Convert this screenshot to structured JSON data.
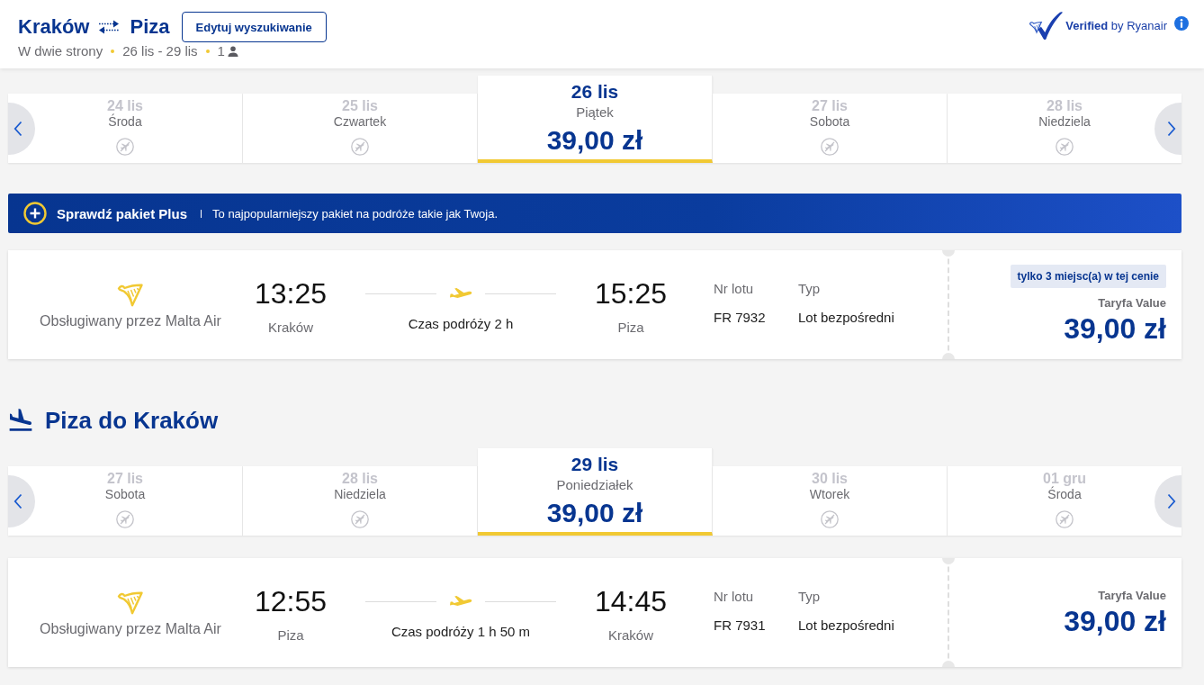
{
  "header": {
    "origin": "Kraków",
    "destination": "Piza",
    "edit_button": "Edytuj wyszukiwanie",
    "trip_type": "W dwie strony",
    "dates": "26 lis - 29 lis",
    "passengers": "1",
    "verified": "**Verified** by Ryanair"
  },
  "journeys": [
    {
      "date_tabs": [
        {
          "date": "24 lis",
          "day": "Środa",
          "selected": false
        },
        {
          "date": "25 lis",
          "day": "Czwartek",
          "selected": false
        },
        {
          "date": "26 lis",
          "day": "Piątek",
          "price": "39,00 zł",
          "selected": true
        },
        {
          "date": "27 lis",
          "day": "Sobota",
          "selected": false
        },
        {
          "date": "28 lis",
          "day": "Niedziela",
          "selected": false
        }
      ],
      "banner": {
        "title": "Sprawdź pakiet Plus",
        "text": "To najpopularniejszy pakiet na podróże takie jak Twoja."
      },
      "flight": {
        "operator": "Obsługiwany przez Malta Air",
        "departure_time": "13:25",
        "departure_city": "Kraków",
        "duration": "Czas podróży 2 h",
        "arrival_time": "15:25",
        "arrival_city": "Piza",
        "flight_number_label": "Nr lotu",
        "flight_number": "FR 7932",
        "type_label": "Typ",
        "type": "Lot bezpośredni",
        "seats_badge": "tylko 3 miejsc(a) w tej cenie",
        "fare": "Taryfa Value",
        "price": "39,00 zł"
      }
    },
    {
      "heading": "Piza do Kraków",
      "date_tabs": [
        {
          "date": "27 lis",
          "day": "Sobota",
          "selected": false
        },
        {
          "date": "28 lis",
          "day": "Niedziela",
          "selected": false
        },
        {
          "date": "29 lis",
          "day": "Poniedziałek",
          "price": "39,00 zł",
          "selected": true
        },
        {
          "date": "30 lis",
          "day": "Wtorek",
          "selected": false
        },
        {
          "date": "01 gru",
          "day": "Środa",
          "selected": false
        }
      ],
      "flight": {
        "operator": "Obsługiwany przez Malta Air",
        "departure_time": "12:55",
        "departure_city": "Piza",
        "duration": "Czas podróży 1 h 50 m",
        "arrival_time": "14:45",
        "arrival_city": "Kraków",
        "flight_number_label": "Nr lotu",
        "flight_number": "FR 7931",
        "type_label": "Typ",
        "type": "Lot bezpośredni",
        "fare": "Taryfa Value",
        "price": "39,00 zł"
      }
    }
  ]
}
